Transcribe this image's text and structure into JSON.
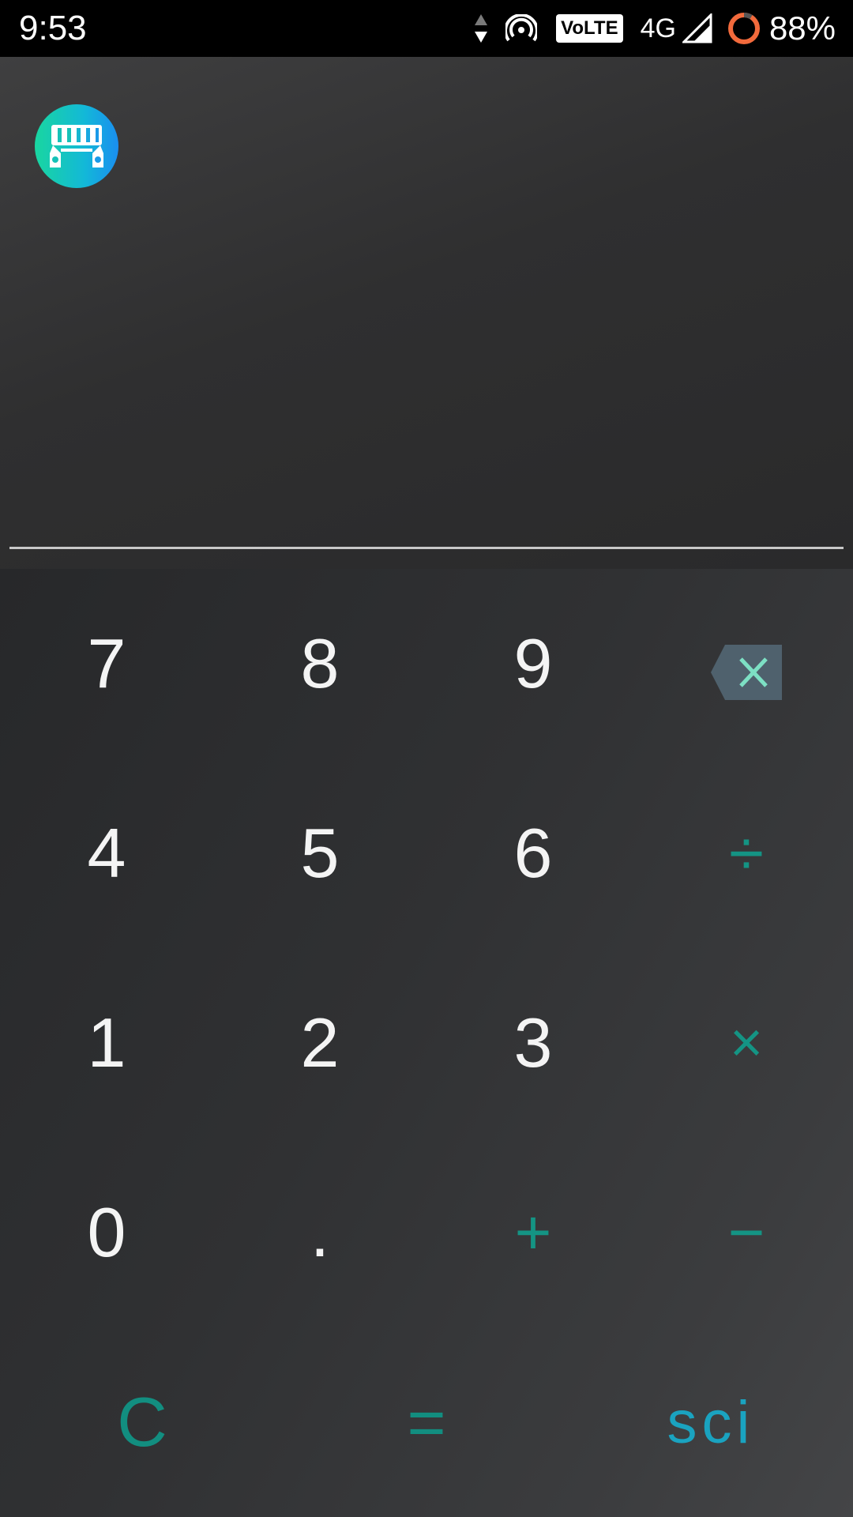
{
  "status_bar": {
    "time": "9:53",
    "volte": "VoLTE",
    "network": "4G",
    "battery": "88%"
  },
  "display": {
    "expression": "",
    "badge_icon": "store-icon"
  },
  "keypad": {
    "row1": [
      "7",
      "8",
      "9"
    ],
    "row2": [
      "4",
      "5",
      "6"
    ],
    "row3": [
      "1",
      "2",
      "3"
    ],
    "row4": [
      "0",
      "."
    ],
    "ops": {
      "divide": "÷",
      "multiply": "×",
      "plus": "+",
      "minus": "−"
    },
    "clear": "C",
    "equals": "=",
    "sci": "sci",
    "backspace_icon": "backspace-icon"
  },
  "colors": {
    "accent_teal": "#149484",
    "sci_blue": "#1aa3c0",
    "backspace_bg": "#4f616d",
    "backspace_x": "#7de0c4",
    "battery_ring": "#f26a3c"
  }
}
